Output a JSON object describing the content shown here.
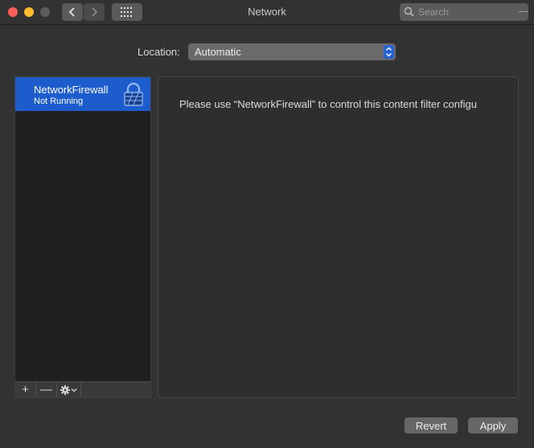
{
  "window": {
    "title": "Network",
    "search_placeholder": "Search"
  },
  "location": {
    "label": "Location:",
    "value": "Automatic"
  },
  "services": [
    {
      "name": "NetworkFirewall",
      "status": "Not Running",
      "icon": "lock-icon",
      "selected": true
    }
  ],
  "service_toolbar": {
    "add": "+",
    "remove": "—"
  },
  "detail": {
    "message": "Please use “NetworkFirewall” to control this content filter configu"
  },
  "buttons": {
    "revert": "Revert",
    "apply": "Apply"
  },
  "colors": {
    "accent": "#1d5ccc",
    "close": "#fe5f57",
    "minimize": "#febc2e"
  }
}
